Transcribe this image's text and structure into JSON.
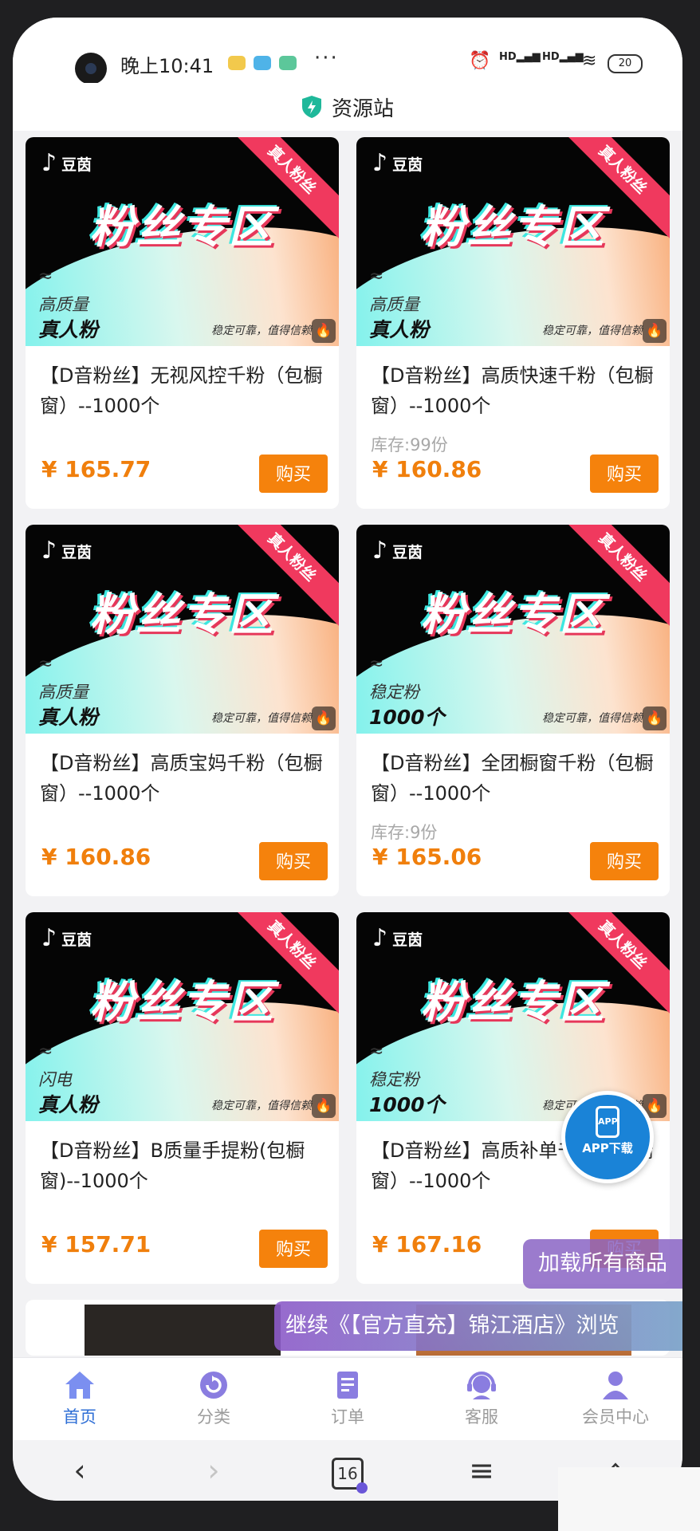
{
  "status_bar": {
    "time": "晚上10:41",
    "dots": "···",
    "net1": "HD",
    "net2": "HD",
    "battery": "20"
  },
  "header": {
    "title": "资源站"
  },
  "products": [
    {
      "brand": "豆茵",
      "banner_title": "粉丝专区",
      "ribbon": "真人粉丝",
      "line1": "高质量",
      "line2": "真人粉",
      "tagline": "稳定可靠，值得信赖",
      "hot": "0",
      "title": "【D音粉丝】无视风控千粉（包橱窗）--1000个",
      "stock": "",
      "price": "¥ 165.77",
      "buy": "购买"
    },
    {
      "brand": "豆茵",
      "banner_title": "粉丝专区",
      "ribbon": "真人粉丝",
      "line1": "高质量",
      "line2": "真人粉",
      "tagline": "稳定可靠，值得信赖",
      "hot": "0",
      "title": "【D音粉丝】高质快速千粉（包橱窗）--1000个",
      "stock": "库存:99份",
      "price": "¥ 160.86",
      "buy": "购买"
    },
    {
      "brand": "豆茵",
      "banner_title": "粉丝专区",
      "ribbon": "真人粉丝",
      "line1": "高质量",
      "line2": "真人粉",
      "tagline": "稳定可靠，值得信赖",
      "hot": "0",
      "title": "【D音粉丝】高质宝妈千粉（包橱窗）--1000个",
      "stock": "",
      "price": "¥ 160.86",
      "buy": "购买"
    },
    {
      "brand": "豆茵",
      "banner_title": "粉丝专区",
      "ribbon": "真人粉丝",
      "line1": "稳定粉",
      "line2": "1000个",
      "tagline": "稳定可靠，值得信赖",
      "hot": "0",
      "title": "【D音粉丝】全团橱窗千粉（包橱窗）--1000个",
      "stock": "库存:9份",
      "price": "¥ 165.06",
      "buy": "购买"
    },
    {
      "brand": "豆茵",
      "banner_title": "粉丝专区",
      "ribbon": "真人粉丝",
      "line1": "闪电",
      "line2": "真人粉",
      "tagline": "稳定可靠，值得信赖",
      "hot": "0",
      "title": "【D音粉丝】B质量手提粉(包橱窗)--1000个",
      "stock": "",
      "price": "¥ 157.71",
      "buy": "购买"
    },
    {
      "brand": "豆茵",
      "banner_title": "粉丝专区",
      "ribbon": "真人粉丝",
      "line1": "稳定粉",
      "line2": "1000个",
      "tagline": "稳定可靠，值得信赖",
      "hot": "0",
      "title": "【D音粉丝】高质补单千粉（包橱窗）--1000个",
      "stock": "",
      "price": "¥ 167.16",
      "buy": "购买"
    }
  ],
  "floating": {
    "app_icon_text": "APP",
    "app_download": "APP下载",
    "load_all": "加载所有商品",
    "continue_browse": "继续《【官方直充】锦江酒店》浏览"
  },
  "tabs": [
    {
      "label": "首页",
      "icon": "home-icon",
      "active": true
    },
    {
      "label": "分类",
      "icon": "category-icon",
      "active": false
    },
    {
      "label": "订单",
      "icon": "order-icon",
      "active": false
    },
    {
      "label": "客服",
      "icon": "service-icon",
      "active": false
    },
    {
      "label": "会员中心",
      "icon": "user-icon",
      "active": false
    }
  ],
  "browser": {
    "back": "‹",
    "forward": "›",
    "tab_count": "16",
    "menu": "≡"
  },
  "colors": {
    "accent": "#f5820c",
    "price": "#f07f0c",
    "tab_active": "#2f6fd6",
    "ribbon": "#f0395e"
  }
}
